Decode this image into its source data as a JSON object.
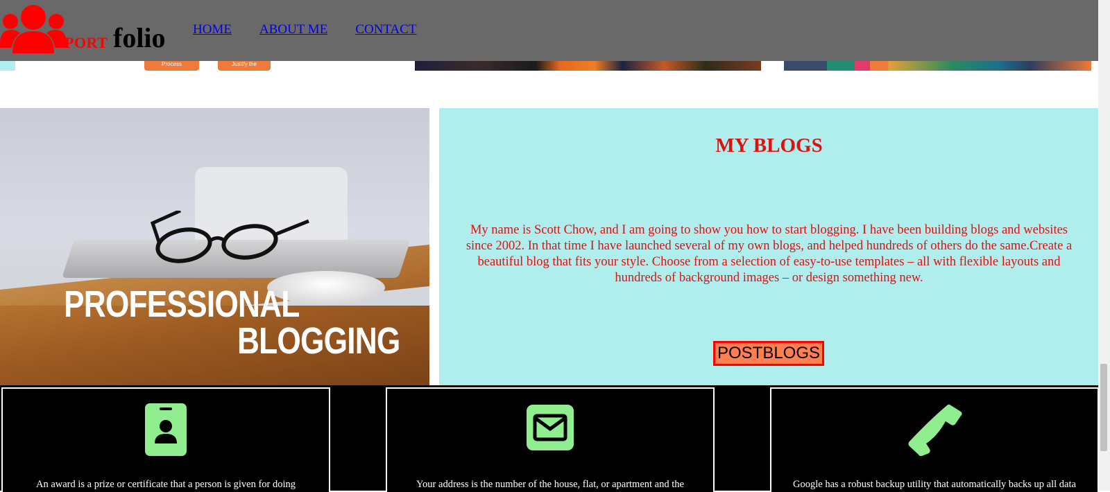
{
  "header": {
    "logo_port": "PORT",
    "logo_folio": "folio",
    "nav": [
      {
        "label": "HOME"
      },
      {
        "label": "ABOUT ME"
      },
      {
        "label": "CONTACT"
      }
    ]
  },
  "hero": {
    "line1": "PROFESSIONAL",
    "line2": "BLOGGING"
  },
  "blog": {
    "title": "MY BLOGS",
    "body": "My name is Scott Chow, and I am going to show you how to start blogging. I have been building blogs and websites since 2002. In that time I have launched several of my own blogs, and helped hundreds of others do the same.Create a beautiful blog that fits your style. Choose from a selection of easy-to-use templates – all with flexible layouts and hundreds of background images – or design something new.",
    "button_label": "POSTBLOGS"
  },
  "strip_images": {
    "img1_button1": "Process",
    "img1_button2": "Justify the"
  },
  "cards": [
    {
      "icon": "id-badge-icon",
      "text": "An award is a prize or certificate that a person is given for doing"
    },
    {
      "icon": "envelope-icon",
      "text": "Your address is the number of the house, flat, or apartment and the"
    },
    {
      "icon": "phone-icon",
      "text": "Google has a robust backup utility that automatically backs up all data"
    }
  ],
  "colors": {
    "header_bg": "#696969",
    "accent_red": "#ff0000",
    "blog_bg": "#b0eded",
    "button_bg": "#ff7f50",
    "icon_green": "#90ee90"
  }
}
